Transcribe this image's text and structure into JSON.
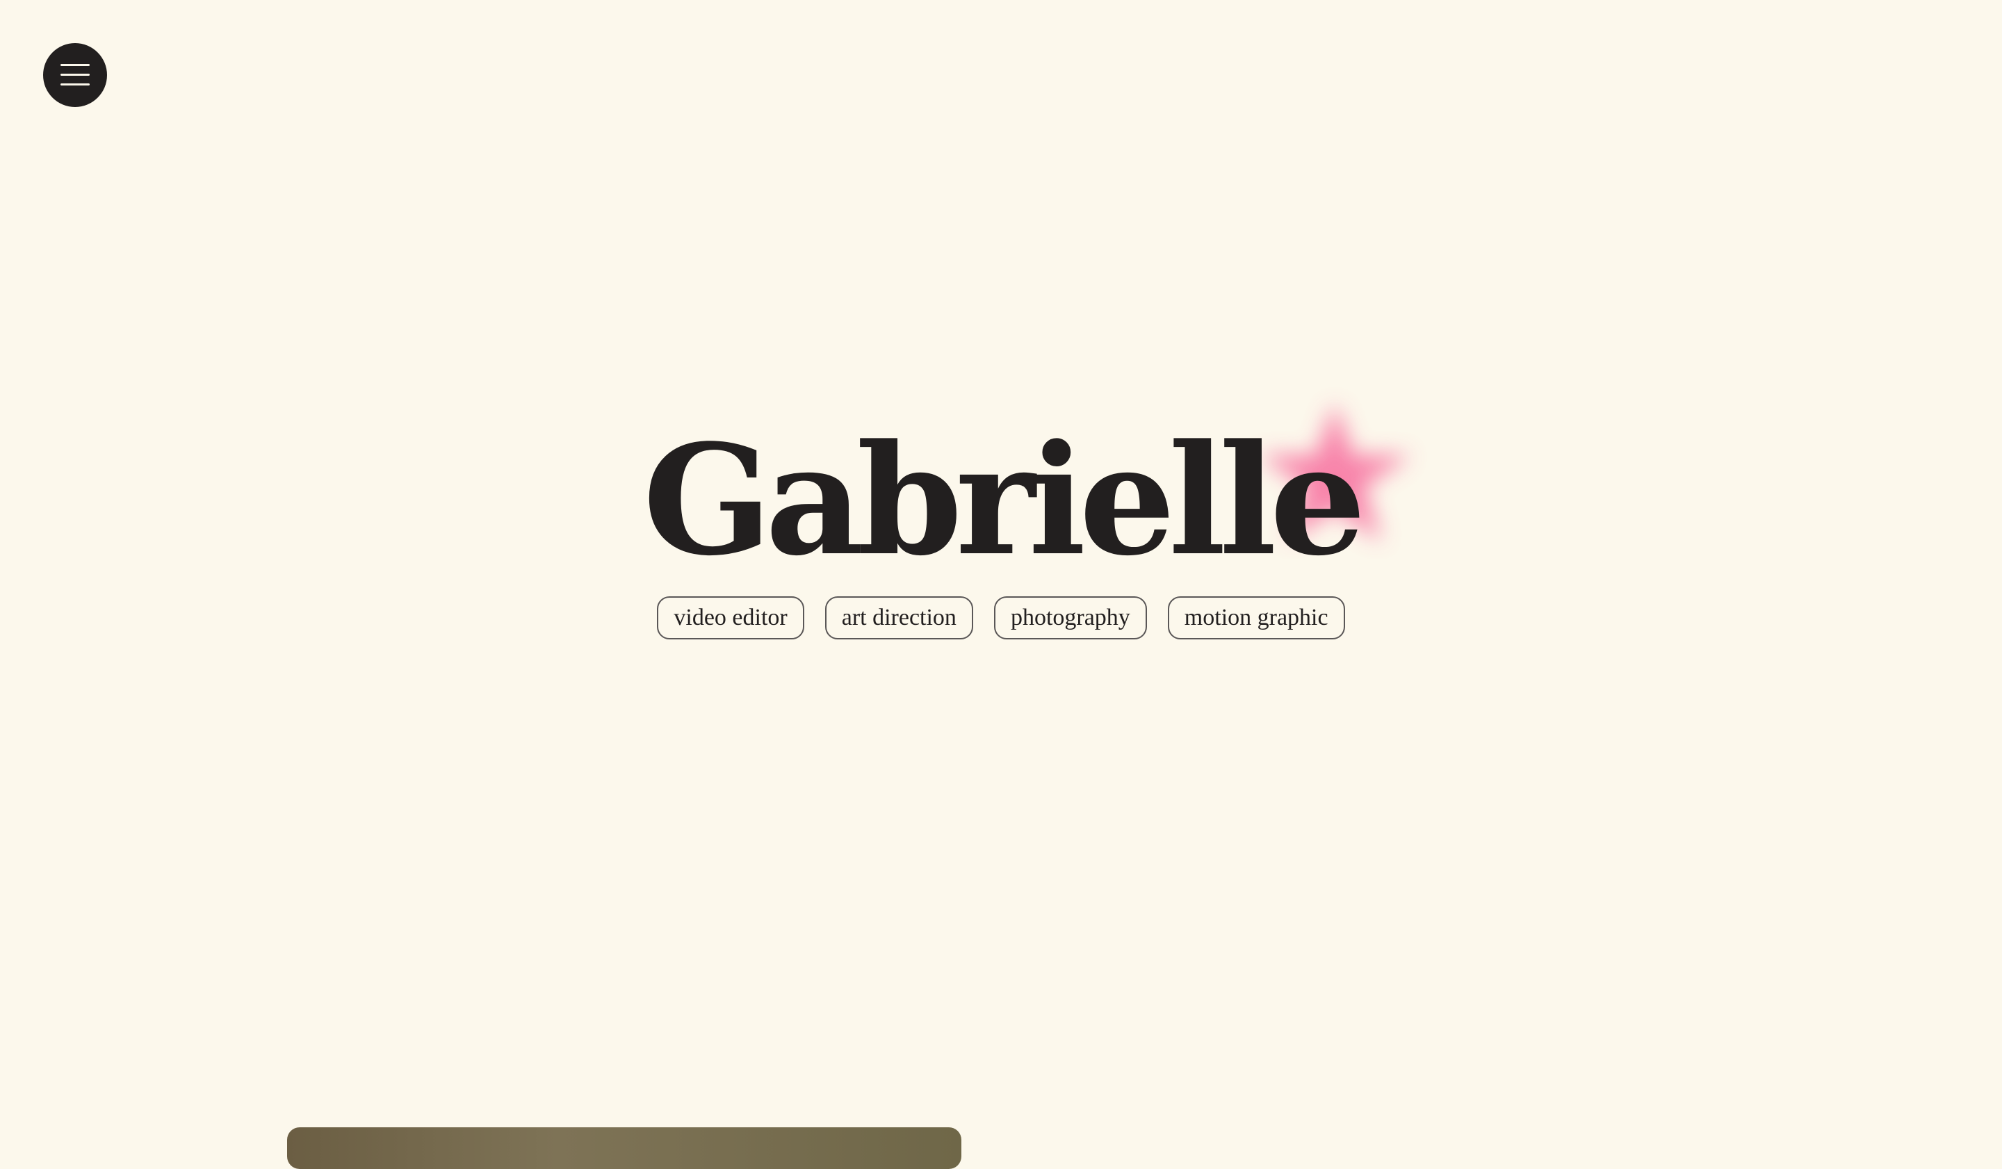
{
  "nav": {
    "menu_icon": "hamburger-icon",
    "menu_button_color": "#221F1F"
  },
  "hero": {
    "title": "Gabrielle",
    "accent_shape": "star-icon",
    "accent_color": "#F7709F",
    "tags": [
      {
        "label": "video editor"
      },
      {
        "label": "art direction"
      },
      {
        "label": "photography"
      },
      {
        "label": "motion graphic"
      }
    ]
  },
  "theme": {
    "background": "#FCF8EC",
    "text": "#221F1F"
  }
}
